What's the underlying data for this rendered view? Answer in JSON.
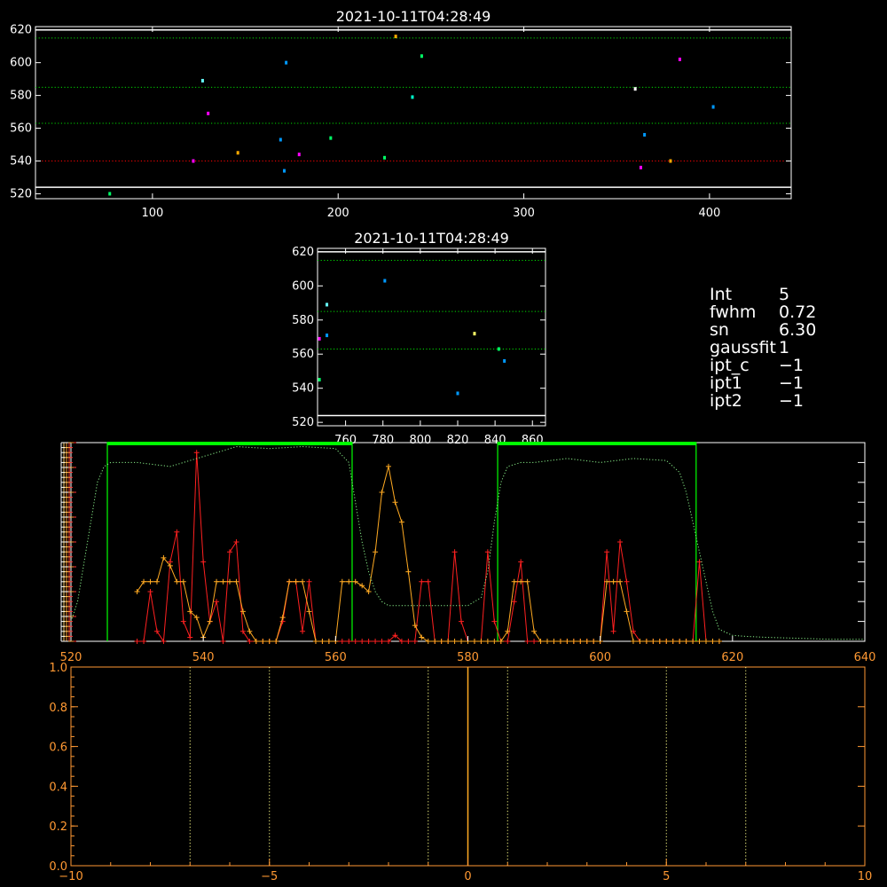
{
  "panels": {
    "top": {
      "title": "2021-10-11T04:28:49",
      "xlim": [
        37,
        444
      ],
      "ylim": [
        517,
        622
      ],
      "xticks": [
        100,
        200,
        300,
        400
      ],
      "yticks": [
        520,
        540,
        560,
        580,
        600,
        620
      ]
    },
    "middle": {
      "title": "2021-10-11T04:28:49",
      "xlim": [
        745,
        867
      ],
      "ylim": [
        518,
        622
      ],
      "xticks": [
        760,
        780,
        800,
        820,
        840,
        860
      ],
      "yticks": [
        520,
        540,
        560,
        580,
        600,
        620
      ]
    },
    "spectrum": {
      "xlim": [
        520,
        640
      ],
      "xticks": [
        520,
        540,
        560,
        580,
        600,
        620,
        640
      ]
    },
    "bottom": {
      "xlim": [
        -10,
        10
      ],
      "ylim": [
        0,
        1
      ],
      "xticks": [
        "−10",
        "−5",
        "0",
        "5",
        "10"
      ],
      "yticks": [
        "0.0",
        "0.2",
        "0.4",
        "0.6",
        "0.8",
        "1.0"
      ]
    }
  },
  "info": [
    {
      "key": "Int",
      "value": "5"
    },
    {
      "key": "fwhm",
      "value": "0.72"
    },
    {
      "key": "sn",
      "value": "6.30"
    },
    {
      "key": "gaussfit",
      "value": "1"
    },
    {
      "key": "ipt_c",
      "value": "−1"
    },
    {
      "key": "ipt1",
      "value": "−1"
    },
    {
      "key": "ipt2",
      "value": "−1"
    }
  ],
  "chart_data": [
    {
      "type": "scatter",
      "title": "2021-10-11T04:28:49",
      "xlim": [
        37,
        444
      ],
      "ylim": [
        517,
        622
      ],
      "hlines": [
        {
          "y": 620,
          "color": "#ffffff",
          "style": "solid"
        },
        {
          "y": 615,
          "color": "#00dd00",
          "style": "dotted"
        },
        {
          "y": 585,
          "color": "#00dd00",
          "style": "dotted"
        },
        {
          "y": 563,
          "color": "#00dd00",
          "style": "dotted"
        },
        {
          "y": 540,
          "color": "#ff0000",
          "style": "dotted"
        },
        {
          "y": 524,
          "color": "#ffffff",
          "style": "solid"
        }
      ],
      "points": [
        {
          "x": 77,
          "y": 520,
          "color": "#00ff66"
        },
        {
          "x": 122,
          "y": 540,
          "color": "#ff00ff"
        },
        {
          "x": 127,
          "y": 589,
          "color": "#66ffff"
        },
        {
          "x": 130,
          "y": 569,
          "color": "#ff00ff"
        },
        {
          "x": 146,
          "y": 545,
          "color": "#ffaa00"
        },
        {
          "x": 169,
          "y": 553,
          "color": "#0099ff"
        },
        {
          "x": 171,
          "y": 534,
          "color": "#0099ff"
        },
        {
          "x": 172,
          "y": 600,
          "color": "#0099ff"
        },
        {
          "x": 179,
          "y": 544,
          "color": "#ff00ff"
        },
        {
          "x": 196,
          "y": 554,
          "color": "#00ff66"
        },
        {
          "x": 225,
          "y": 542,
          "color": "#00ff66"
        },
        {
          "x": 231,
          "y": 616,
          "color": "#ffaa00"
        },
        {
          "x": 240,
          "y": 579,
          "color": "#00ffcc"
        },
        {
          "x": 245,
          "y": 604,
          "color": "#00ff66"
        },
        {
          "x": 360,
          "y": 584,
          "color": "#ffffff"
        },
        {
          "x": 363,
          "y": 536,
          "color": "#ff00ff"
        },
        {
          "x": 365,
          "y": 556,
          "color": "#0099ff"
        },
        {
          "x": 379,
          "y": 540,
          "color": "#ffaa00"
        },
        {
          "x": 384,
          "y": 602,
          "color": "#ff00ff"
        },
        {
          "x": 402,
          "y": 573,
          "color": "#0099ff"
        }
      ]
    },
    {
      "type": "scatter",
      "title": "2021-10-11T04:28:49",
      "xlim": [
        745,
        867
      ],
      "ylim": [
        518,
        622
      ],
      "hlines": [
        {
          "y": 620,
          "color": "#ffffff",
          "style": "solid"
        },
        {
          "y": 615,
          "color": "#00dd00",
          "style": "dotted"
        },
        {
          "y": 585,
          "color": "#00dd00",
          "style": "dotted"
        },
        {
          "y": 563,
          "color": "#00dd00",
          "style": "dotted"
        },
        {
          "y": 524,
          "color": "#ffffff",
          "style": "solid"
        }
      ],
      "points": [
        {
          "x": 746,
          "y": 545,
          "color": "#00ff66"
        },
        {
          "x": 746,
          "y": 569,
          "color": "#ff00ff"
        },
        {
          "x": 750,
          "y": 589,
          "color": "#66ffff"
        },
        {
          "x": 750,
          "y": 571,
          "color": "#0099ff"
        },
        {
          "x": 781,
          "y": 603,
          "color": "#0099ff"
        },
        {
          "x": 820,
          "y": 537,
          "color": "#0099ff"
        },
        {
          "x": 829,
          "y": 572,
          "color": "#ffff66"
        },
        {
          "x": 842,
          "y": 563,
          "color": "#00ff66"
        },
        {
          "x": 845,
          "y": 556,
          "color": "#0099ff"
        }
      ]
    },
    {
      "type": "line",
      "xlim": [
        520,
        640
      ],
      "windows": [
        [
          525.5,
          562.5
        ],
        [
          584.5,
          614.5
        ]
      ],
      "series": [
        {
          "color": "#ff2020",
          "markers": true,
          "x": [
            530,
            531,
            532,
            533,
            534,
            535,
            536,
            537,
            538,
            539,
            540,
            541,
            542,
            543,
            544,
            545,
            546,
            547,
            548,
            549,
            550,
            551,
            552,
            553,
            554,
            555,
            556,
            557,
            558,
            559,
            560,
            561,
            562,
            563,
            564,
            565,
            566,
            567,
            568,
            569,
            570,
            571,
            572,
            573,
            574,
            575,
            576,
            577,
            578,
            579,
            580,
            581,
            582,
            583,
            584,
            585,
            586,
            587,
            588,
            589,
            590,
            591,
            592,
            593,
            594,
            595,
            596,
            597,
            598,
            599,
            600,
            601,
            602,
            603,
            604,
            605,
            606,
            607,
            608,
            609,
            610,
            611,
            612,
            613,
            614,
            615,
            616,
            617,
            618
          ],
          "y": [
            0,
            0,
            0.25,
            0.05,
            0,
            0.4,
            0.55,
            0.1,
            0.02,
            0.95,
            0.4,
            0.1,
            0.2,
            0,
            0.45,
            0.5,
            0.05,
            0,
            0,
            0,
            0,
            0,
            0.1,
            0.3,
            0.3,
            0.05,
            0.3,
            0,
            0,
            0,
            0,
            0,
            0,
            0,
            0,
            0,
            0,
            0,
            0,
            0.03,
            0,
            0,
            0,
            0.3,
            0.3,
            0,
            0,
            0,
            0.45,
            0.1,
            0,
            0,
            0,
            0.45,
            0.1,
            0,
            0,
            0.2,
            0.4,
            0,
            0,
            0,
            0,
            0,
            0,
            0,
            0,
            0,
            0,
            0,
            0,
            0.45,
            0.05,
            0.5,
            0.3,
            0.05,
            0,
            0,
            0,
            0,
            0,
            0,
            0,
            0,
            0,
            0.4,
            0,
            0,
            0
          ]
        },
        {
          "color": "#ffaa22",
          "markers": true,
          "x": [
            530,
            531,
            532,
            533,
            534,
            535,
            536,
            537,
            538,
            539,
            540,
            541,
            542,
            543,
            544,
            545,
            546,
            547,
            548,
            549,
            550,
            551,
            552,
            553,
            554,
            555,
            556,
            557,
            558,
            559,
            560,
            561,
            562,
            563,
            564,
            565,
            566,
            567,
            568,
            569,
            570,
            571,
            572,
            573,
            574,
            575,
            576,
            577,
            578,
            579,
            580,
            581,
            582,
            583,
            584,
            585,
            586,
            587,
            588,
            589,
            590,
            591,
            592,
            593,
            594,
            595,
            596,
            597,
            598,
            599,
            600,
            601,
            602,
            603,
            604,
            605,
            606,
            607,
            608,
            609,
            610,
            611,
            612,
            613,
            614,
            615,
            616,
            617,
            618
          ],
          "y": [
            0.25,
            0.3,
            0.3,
            0.3,
            0.42,
            0.38,
            0.3,
            0.3,
            0.15,
            0.12,
            0.02,
            0.1,
            0.3,
            0.3,
            0.3,
            0.3,
            0.15,
            0.05,
            0,
            0,
            0,
            0,
            0.12,
            0.3,
            0.3,
            0.3,
            0.15,
            0,
            0,
            0,
            0,
            0.3,
            0.3,
            0.3,
            0.28,
            0.25,
            0.45,
            0.75,
            0.88,
            0.7,
            0.6,
            0.35,
            0.08,
            0.02,
            0,
            0,
            0,
            0,
            0,
            0,
            0,
            0,
            0,
            0,
            0,
            0,
            0.05,
            0.3,
            0.3,
            0.3,
            0.05,
            0,
            0,
            0,
            0,
            0,
            0,
            0,
            0,
            0,
            0,
            0.3,
            0.3,
            0.3,
            0.15,
            0,
            0,
            0,
            0,
            0,
            0,
            0,
            0,
            0,
            0,
            0,
            0,
            0,
            0
          ]
        },
        {
          "color": "#88ee88",
          "markers": false,
          "style": "dotted",
          "x": [
            520,
            521,
            522,
            523,
            524,
            525,
            526,
            527,
            528,
            530,
            535,
            540,
            545,
            550,
            555,
            560,
            562,
            563,
            564,
            565,
            566,
            567,
            568,
            570,
            575,
            580,
            582,
            583,
            584,
            585,
            586,
            588,
            590,
            595,
            600,
            605,
            610,
            612,
            613,
            614,
            615,
            616,
            617,
            618,
            620,
            622,
            625,
            630,
            635,
            640
          ],
          "y": [
            0.1,
            0.2,
            0.4,
            0.6,
            0.8,
            0.88,
            0.9,
            0.9,
            0.9,
            0.9,
            0.88,
            0.93,
            0.98,
            0.97,
            0.98,
            0.97,
            0.9,
            0.7,
            0.5,
            0.35,
            0.25,
            0.2,
            0.18,
            0.18,
            0.18,
            0.18,
            0.22,
            0.35,
            0.6,
            0.8,
            0.88,
            0.9,
            0.9,
            0.92,
            0.9,
            0.92,
            0.91,
            0.85,
            0.75,
            0.6,
            0.45,
            0.3,
            0.15,
            0.06,
            0.03,
            0.025,
            0.02,
            0.015,
            0.01,
            0.01
          ]
        }
      ]
    },
    {
      "type": "line",
      "xlim": [
        -10,
        10
      ],
      "ylim": [
        0,
        1
      ],
      "vlines": [
        {
          "x": -7,
          "color": "#ffff88",
          "style": "dotted"
        },
        {
          "x": -5,
          "color": "#ffff88",
          "style": "dotted"
        },
        {
          "x": -1,
          "color": "#ffff88",
          "style": "dotted"
        },
        {
          "x": 0,
          "color": "#ffaa22",
          "style": "solid"
        },
        {
          "x": 1,
          "color": "#ffff88",
          "style": "dotted"
        },
        {
          "x": 5,
          "color": "#ffff88",
          "style": "dotted"
        },
        {
          "x": 7,
          "color": "#ffff88",
          "style": "dotted"
        }
      ]
    }
  ]
}
